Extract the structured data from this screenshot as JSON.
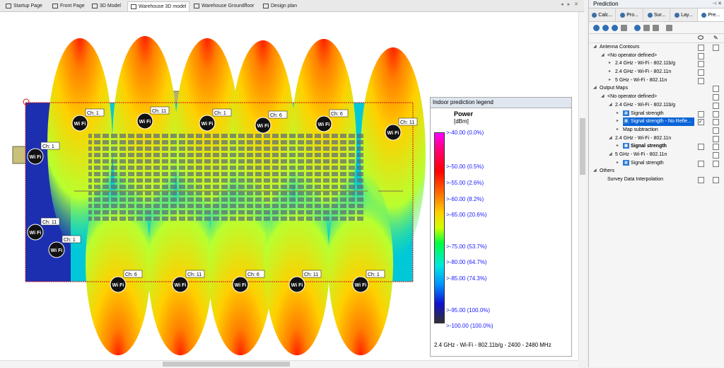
{
  "tabs": [
    {
      "label": "Startup Page",
      "icon": "home-icon"
    },
    {
      "label": "Front Page",
      "icon": "picture-icon"
    },
    {
      "label": "3D Model",
      "icon": "picture-icon"
    },
    {
      "label": "Warehouse 3D model",
      "icon": "picture-icon",
      "active": true
    },
    {
      "label": "Warehouse Groundfloor",
      "icon": "picture-icon"
    },
    {
      "label": "Design plan",
      "icon": "plan-icon"
    }
  ],
  "map": {
    "aps": [
      {
        "channel": "Ch: 1",
        "dir": "down"
      },
      {
        "channel": "Ch: 11",
        "dir": "down"
      },
      {
        "channel": "Ch: 1",
        "dir": "down"
      },
      {
        "channel": "Ch: 6",
        "dir": "down"
      },
      {
        "channel": "Ch: 6",
        "dir": "down"
      },
      {
        "channel": "Ch: 11",
        "dir": "down"
      },
      {
        "channel": "Ch: 1",
        "dir": "none"
      },
      {
        "channel": "Ch: 11",
        "dir": "none"
      },
      {
        "channel": "Ch: 1",
        "dir": "none"
      },
      {
        "channel": "Ch: 6",
        "dir": "up"
      },
      {
        "channel": "Ch: 11",
        "dir": "up"
      },
      {
        "channel": "Ch: 6",
        "dir": "up"
      },
      {
        "channel": "Ch: 11",
        "dir": "up"
      },
      {
        "channel": "Ch: 1",
        "dir": "up"
      }
    ],
    "wifi_text": "Wi Fi"
  },
  "legend": {
    "title": "Indoor prediction legend",
    "power": "Power",
    "unit": "[dBm]",
    "labels": [
      ">-40.00 (0.0%)",
      ">-50.00 (0.5%)",
      ">-55.00 (2.6%)",
      ">-60.00 (8.2%)",
      ">-65.00 (20.6%)",
      ">-75.00 (53.7%)",
      ">-80.00 (64.7%)",
      ">-85.00 (74.3%)",
      ">-95.00 (100.0%)",
      ">-100.00 (100.0%)"
    ],
    "footer": "2.4 GHz - Wi-Fi - 802.11b/g - 2400 - 2480 MHz"
  },
  "panel": {
    "title": "Prediction",
    "tabs": [
      {
        "label": "Calc..."
      },
      {
        "label": "Pro..."
      },
      {
        "label": "Sur..."
      },
      {
        "label": "Lay..."
      },
      {
        "label": "Pre...",
        "active": true
      }
    ],
    "tree": [
      {
        "label": "Antenna Contours",
        "indent": 0,
        "exp": "down",
        "cb1": false,
        "cb2": false
      },
      {
        "label": "<No operator defined>",
        "indent": 1,
        "exp": "down",
        "cb1": false
      },
      {
        "label": "2.4 GHz - Wi-Fi - 802.11b/g",
        "indent": 2,
        "exp": "right",
        "cb1": false
      },
      {
        "label": "2.4 GHz - Wi-Fi - 802.11n",
        "indent": 2,
        "exp": "right",
        "cb1": false
      },
      {
        "label": "5 GHz - Wi-Fi - 802.11n",
        "indent": 2,
        "exp": "right",
        "cb1": false
      },
      {
        "label": "Output Maps",
        "indent": 0,
        "exp": "down",
        "cb2": false
      },
      {
        "label": "<No operator defined>",
        "indent": 1,
        "exp": "down",
        "cb2": false
      },
      {
        "label": "2.4 GHz - Wi-Fi - 802.11b/g",
        "indent": 2,
        "exp": "down",
        "cb2": false
      },
      {
        "label": "Signal strength",
        "indent": 3,
        "exp": "right",
        "icon": true,
        "cb1": false,
        "cb2": false
      },
      {
        "label": "Signal strength - No Refle...",
        "indent": 3,
        "exp": "right",
        "icon": true,
        "selected": true,
        "cb1": true,
        "cb2": false
      },
      {
        "label": "Map subtraction",
        "indent": 3,
        "exp": "right",
        "cb2": false
      },
      {
        "label": "2.4 GHz - Wi-Fi - 802.11n",
        "indent": 2,
        "exp": "down",
        "cb2": false
      },
      {
        "label": "Signal strength",
        "indent": 3,
        "exp": "right",
        "icon": true,
        "bold": true,
        "cb1": false,
        "cb2": false
      },
      {
        "label": "5 GHz - Wi-Fi - 802.11n",
        "indent": 2,
        "exp": "down",
        "cb2": false
      },
      {
        "label": "Signal strength",
        "indent": 3,
        "exp": "right",
        "icon": true,
        "cb1": false,
        "cb2": false
      },
      {
        "label": "Others",
        "indent": 0,
        "exp": "down"
      },
      {
        "label": "Survey Data Interpolation",
        "indent": 1,
        "exp": "none",
        "cb1": false,
        "cb2": false
      }
    ]
  }
}
